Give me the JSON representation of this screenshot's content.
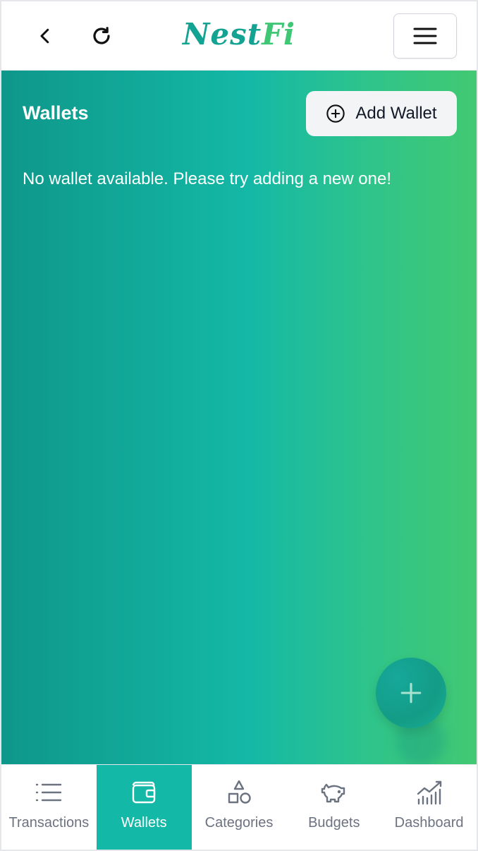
{
  "header": {
    "logo_main": "Nest",
    "logo_accent": "Fi"
  },
  "main": {
    "title": "Wallets",
    "add_wallet_label": "Add Wallet",
    "empty_message": "No wallet available. Please try adding a new one!"
  },
  "fab": {
    "icon": "plus-icon"
  },
  "bottom_nav": {
    "items": [
      {
        "label": "Transactions",
        "icon": "list-icon",
        "active": false
      },
      {
        "label": "Wallets",
        "icon": "wallet-icon",
        "active": true
      },
      {
        "label": "Categories",
        "icon": "shapes-icon",
        "active": false
      },
      {
        "label": "Budgets",
        "icon": "piggy-bank-icon",
        "active": false
      },
      {
        "label": "Dashboard",
        "icon": "chart-icon",
        "active": false
      }
    ]
  },
  "colors": {
    "brand_teal": "#14b8a6",
    "brand_green": "#42c972",
    "nav_inactive": "#6b7280"
  }
}
